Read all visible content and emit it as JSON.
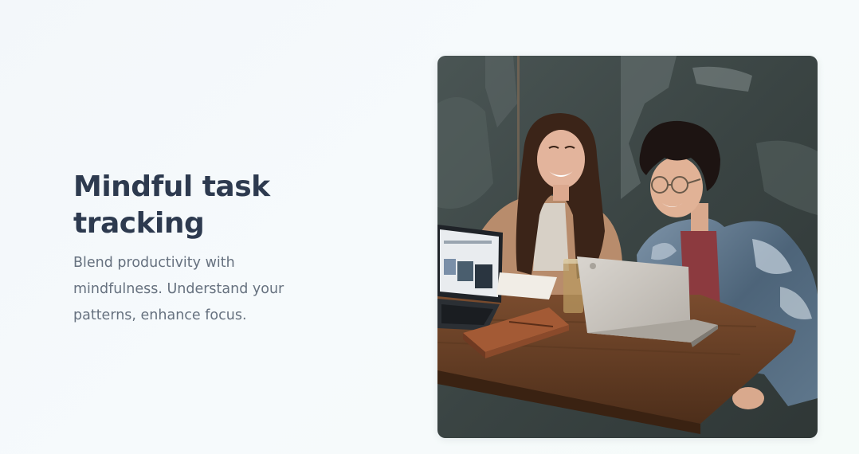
{
  "hero": {
    "title": "Mindful task tracking",
    "description": "Blend productivity with mindfulness. Understand your patterns, enhance focus."
  },
  "image": {
    "subject": "two people laughing at a wooden table with laptops and a leather notebook",
    "colors": {
      "wall": "#3f4a4a",
      "table": "#6b4328",
      "notebook": "#a35a35",
      "laptop": "#cfcac2"
    }
  }
}
